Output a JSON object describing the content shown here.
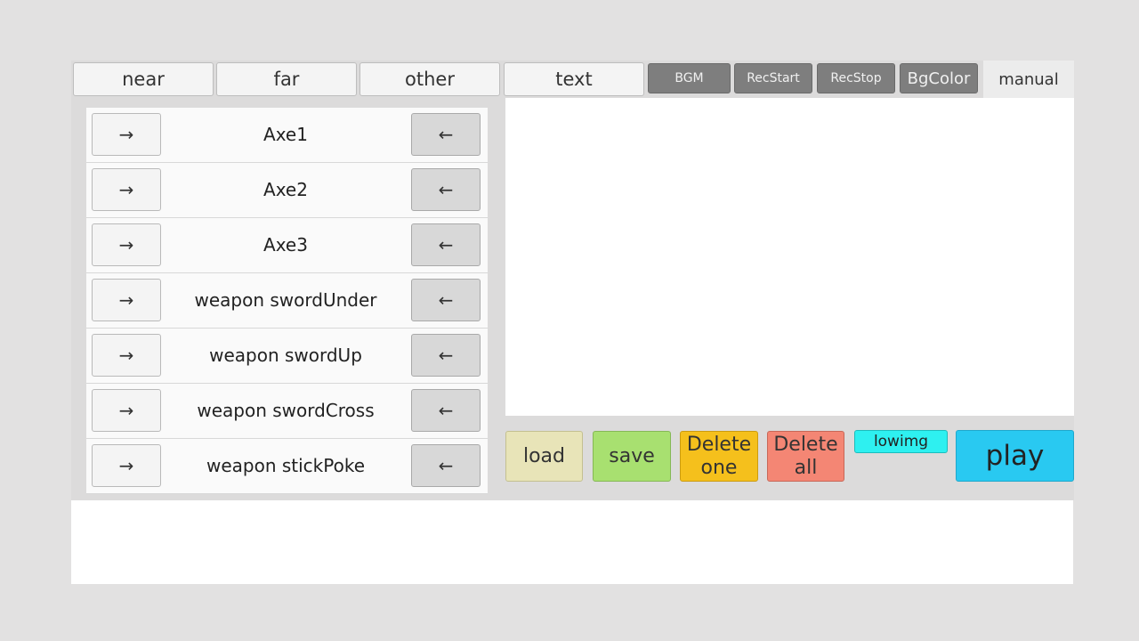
{
  "tabs": [
    {
      "label": "near"
    },
    {
      "label": "far"
    },
    {
      "label": "other"
    },
    {
      "label": "text"
    }
  ],
  "toolbar": {
    "bgm": "BGM",
    "rec_start": "RecStart",
    "rec_stop": "RecStop",
    "bg_color": "BgColor",
    "manual": "manual"
  },
  "items": [
    {
      "label": "Axe1",
      "add": "→",
      "remove": "←"
    },
    {
      "label": "Axe2",
      "add": "→",
      "remove": "←"
    },
    {
      "label": "Axe3",
      "add": "→",
      "remove": "←"
    },
    {
      "label": "weapon swordUnder",
      "add": "→",
      "remove": "←"
    },
    {
      "label": "weapon swordUp",
      "add": "→",
      "remove": "←"
    },
    {
      "label": "weapon swordCross",
      "add": "→",
      "remove": "←"
    },
    {
      "label": "weapon stickPoke",
      "add": "→",
      "remove": "←"
    }
  ],
  "actions": {
    "load": "load",
    "save": "save",
    "delete_one_line1": "Delete",
    "delete_one_line2": "one",
    "delete_all_line1": "Delete",
    "delete_all_line2": "all",
    "lowimg": "lowimg",
    "play": "play"
  },
  "colors": {
    "load": "#e8e4b8",
    "save": "#a8e070",
    "delete_one": "#f5c01c",
    "delete_all": "#f48674",
    "lowimg": "#2ef0f0",
    "play": "#29c9f1"
  }
}
